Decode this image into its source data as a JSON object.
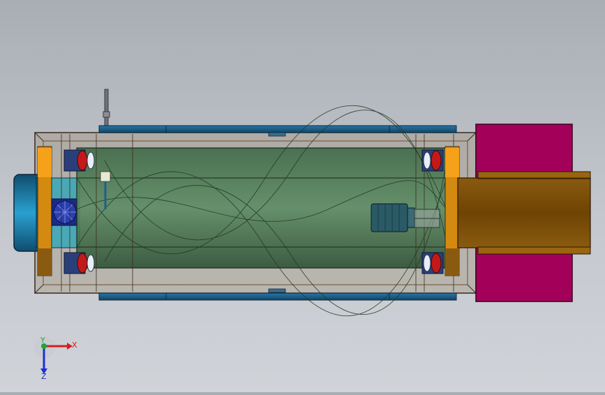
{
  "viewport": {
    "background_top": "#a9adb4",
    "background_bottom": "#d0d3d8"
  },
  "triad": {
    "x_label": "X",
    "y_label": "Y",
    "z_label": "Z",
    "x_color": "#d41e1e",
    "y_color": "#1ea63a",
    "z_color": "#1e2fd4"
  },
  "model": {
    "drum_color": "#4f7a55",
    "frame_color": "#8a6a45",
    "rail_color": "#1e5f8a",
    "orange_block_color": "#f5a11a",
    "magenta_block_color": "#a3005a",
    "chute_color": "#7a4a05",
    "motor_color": "#2a5a66",
    "end_cap_color": "#1b7fa8"
  }
}
